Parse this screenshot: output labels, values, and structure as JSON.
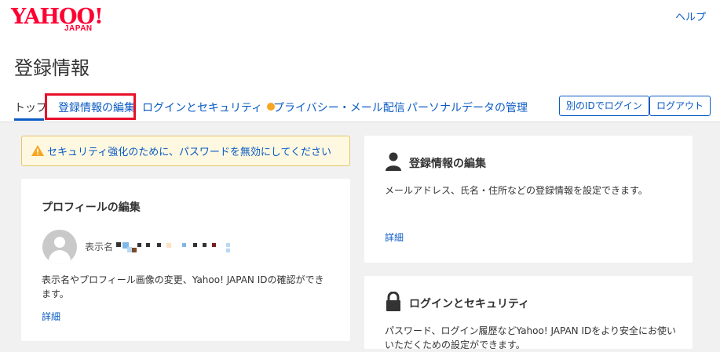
{
  "header": {
    "logo_text": "YAHOO!",
    "logo_sub": "JAPAN",
    "help_label": "ヘルプ",
    "page_title": "登録情報",
    "tabs": [
      {
        "label": "トップ"
      },
      {
        "label": "登録情報の編集"
      },
      {
        "label": "ログインとセキュリティ"
      },
      {
        "label": "プライバシー・メール配信"
      },
      {
        "label": "パーソナルデータの管理"
      }
    ],
    "login_other_label": "別のIDでログイン",
    "logout_label": "ログアウト"
  },
  "alert": {
    "text": "セキュリティ強化のために、パスワードを無効にしてください"
  },
  "profile_card": {
    "title": "プロフィールの編集",
    "name_label": "表示名",
    "desc": "表示名やプロフィール画像の変更、Yahoo! JAPAN IDの確認ができます。",
    "link": "詳細"
  },
  "edit_card": {
    "title": "登録情報の編集",
    "desc": "メールアドレス、氏名・住所などの登録情報を設定できます。",
    "link": "詳細"
  },
  "security_card": {
    "title": "ログインとセキュリティ",
    "desc": "パスワード、ログイン履歴などYahoo! JAPAN IDをより安全にお使いいただくための設定ができます。"
  },
  "colors": {
    "link": "#0a5bc4",
    "highlight": "#e8102a",
    "notice_dot": "#f5a623",
    "brand": "#ff0033"
  }
}
